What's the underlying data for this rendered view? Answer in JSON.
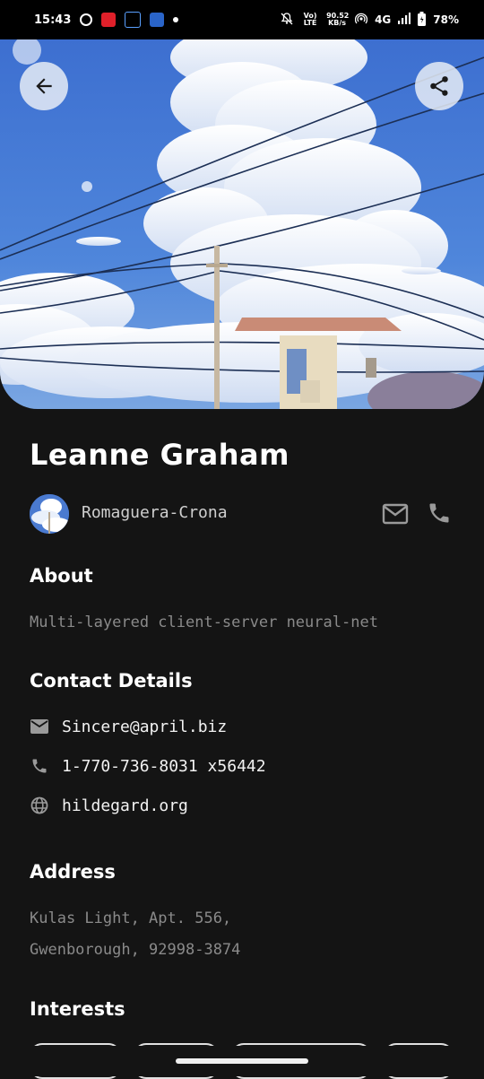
{
  "status_bar": {
    "time": "15:43",
    "signal_top": "Vo) LTE",
    "speed_value": "90.52",
    "speed_unit": "KB/s",
    "network": "4G",
    "battery": "78%"
  },
  "profile": {
    "name": "Leanne Graham",
    "company": "Romaguera-Crona"
  },
  "about": {
    "title": "About",
    "text": "Multi-layered client-server neural-net"
  },
  "contact": {
    "title": "Contact Details",
    "email": "Sincere@april.biz",
    "phone": "1-770-736-8031 x56442",
    "website": "hildegard.org"
  },
  "address": {
    "title": "Address",
    "line1": "Kulas Light, Apt. 556,",
    "line2": "Gwenborough, 92998-3874"
  },
  "interests": {
    "title": "Interests"
  },
  "colors": {
    "background": "#141414",
    "muted_text": "#8a8a8a",
    "sky": "#3f74d4"
  }
}
